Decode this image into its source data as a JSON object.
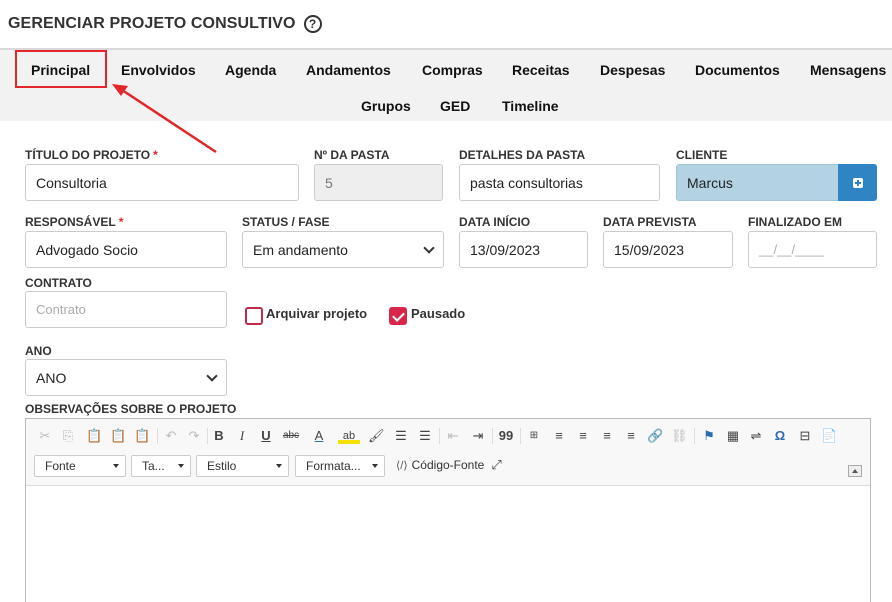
{
  "header": {
    "title": "GERENCIAR PROJETO CONSULTIVO",
    "help_icon": "?"
  },
  "tabs": [
    {
      "label": "Principal",
      "active": true
    },
    {
      "label": "Envolvidos"
    },
    {
      "label": "Agenda"
    },
    {
      "label": "Andamentos"
    },
    {
      "label": "Compras"
    },
    {
      "label": "Receitas"
    },
    {
      "label": "Despesas"
    },
    {
      "label": "Documentos"
    },
    {
      "label": "Mensagens"
    },
    {
      "label": "Grupos"
    },
    {
      "label": "GED"
    },
    {
      "label": "Timeline"
    }
  ],
  "form": {
    "titulo": {
      "label": "TÍTULO DO PROJETO",
      "required": "*",
      "value": "Consultoria"
    },
    "pasta": {
      "label": "Nº DA PASTA",
      "value": "5"
    },
    "detalhes": {
      "label": "DETALHES DA PASTA",
      "value": "pasta consultorias"
    },
    "cliente": {
      "label": "CLIENTE",
      "value": "Marcus"
    },
    "responsavel": {
      "label": "RESPONSÁVEL",
      "required": "*",
      "value": "Advogado Socio"
    },
    "status": {
      "label": "STATUS / FASE",
      "value": "Em andamento"
    },
    "data_inicio": {
      "label": "DATA INÍCIO",
      "value": "13/09/2023"
    },
    "data_prevista": {
      "label": "DATA PREVISTA",
      "value": "15/09/2023"
    },
    "finalizado": {
      "label": "FINALIZADO EM",
      "placeholder": "__/__/____"
    },
    "contrato": {
      "label": "CONTRATO",
      "placeholder": "Contrato"
    },
    "arquivar": {
      "label": "Arquivar projeto",
      "checked": false
    },
    "pausado": {
      "label": "Pausado",
      "checked": true
    },
    "ano": {
      "label": "ANO",
      "value": "ANO"
    },
    "observacoes": {
      "label": "OBSERVAÇÕES SOBRE O PROJETO"
    }
  },
  "editor": {
    "combos": {
      "fonte": "Fonte",
      "tamanho": "Ta...",
      "estilo": "Estilo",
      "formatacao": "Formata..."
    },
    "source_label": "Código-Fonte",
    "glyphs": {
      "bold": "B",
      "italic": "I",
      "underline": "U",
      "strike": "abc",
      "font_color": "A",
      "bg_color": "ab",
      "blockquote": "99",
      "special_char": "Ω"
    }
  },
  "colors": {
    "accent": "#2f84c3",
    "highlight": "#e3262c",
    "cliente_bg": "#b3d3e3",
    "checkbox": "#d8264a"
  }
}
